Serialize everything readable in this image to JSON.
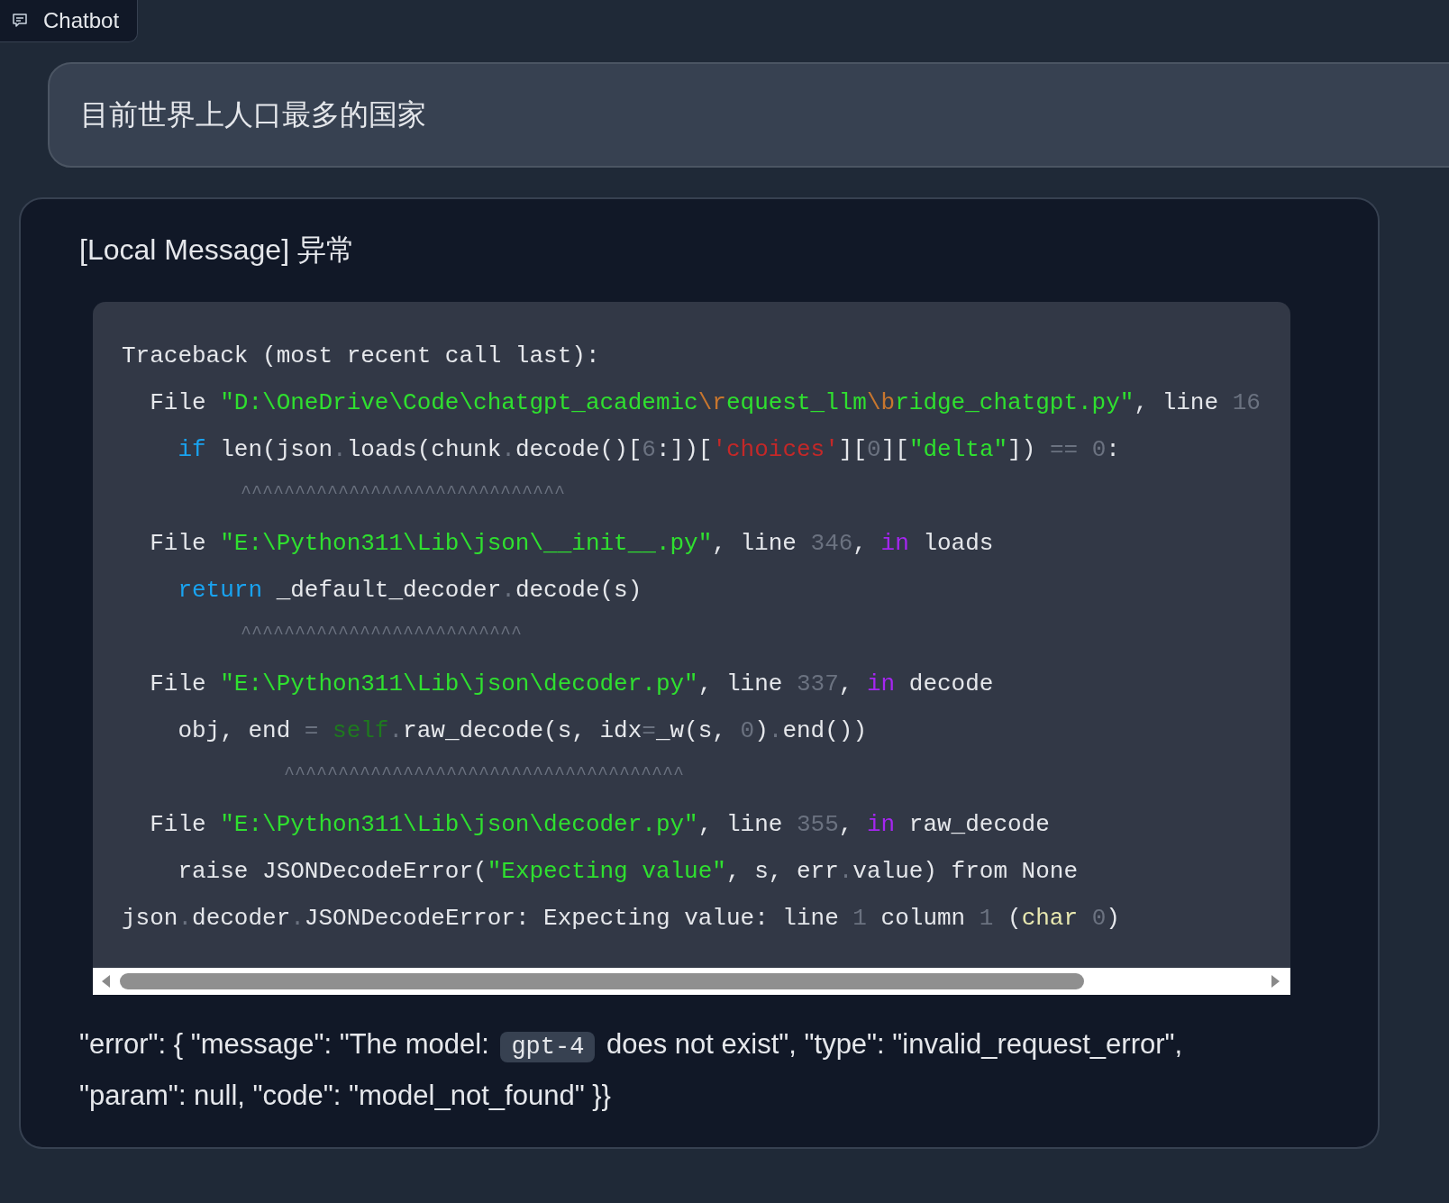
{
  "header_tab": {
    "label": "Chatbot"
  },
  "messages": [
    {
      "kind": "user",
      "text": "目前世界上人口最多的国家"
    },
    {
      "kind": "bot",
      "title": "[Local Message] 异常",
      "code_lines": [
        {
          "kind": "code",
          "tokens": [
            {
              "kind": "t",
              "text": "Traceback (most recent call last):"
            }
          ]
        },
        {
          "kind": "code",
          "tokens": [
            {
              "kind": "t",
              "text": "  File "
            },
            {
              "kind": "s",
              "text": "\"D:\\OneDrive\\Code\\chatgpt_academic"
            },
            {
              "kind": "e",
              "text": "\\r"
            },
            {
              "kind": "s",
              "text": "equest_llm"
            },
            {
              "kind": "e",
              "text": "\\b"
            },
            {
              "kind": "s",
              "text": "ridge_chatgpt.py\""
            },
            {
              "kind": "t",
              "text": ", line "
            },
            {
              "kind": "n",
              "text": "16"
            }
          ]
        },
        {
          "kind": "code",
          "tokens": [
            {
              "kind": "k",
              "text": "    if"
            },
            {
              "kind": "t",
              "text": " len(json"
            },
            {
              "kind": "o",
              "text": "."
            },
            {
              "kind": "t",
              "text": "loads(chunk"
            },
            {
              "kind": "o",
              "text": "."
            },
            {
              "kind": "t",
              "text": "decode()["
            },
            {
              "kind": "n",
              "text": "6"
            },
            {
              "kind": "t",
              "text": ":])["
            },
            {
              "kind": "r",
              "text": "'choices'"
            },
            {
              "kind": "t",
              "text": "]["
            },
            {
              "kind": "n",
              "text": "0"
            },
            {
              "kind": "t",
              "text": "]["
            },
            {
              "kind": "s",
              "text": "\"delta\""
            },
            {
              "kind": "t",
              "text": "]) "
            },
            {
              "kind": "o",
              "text": "=="
            },
            {
              "kind": "n",
              "text": " 0"
            },
            {
              "kind": "t",
              "text": ":"
            }
          ]
        },
        {
          "kind": "carets",
          "text": "           ^^^^^^^^^^^^^^^^^^^^^^^^^^^^^^"
        },
        {
          "kind": "code",
          "tokens": [
            {
              "kind": "t",
              "text": "  File "
            },
            {
              "kind": "s",
              "text": "\"E:\\Python311\\Lib\\json\\__init__.py\""
            },
            {
              "kind": "t",
              "text": ", line "
            },
            {
              "kind": "n",
              "text": "346"
            },
            {
              "kind": "t",
              "text": ", "
            },
            {
              "kind": "p",
              "text": "in"
            },
            {
              "kind": "t",
              "text": " loads"
            }
          ]
        },
        {
          "kind": "code",
          "tokens": [
            {
              "kind": "k",
              "text": "    return"
            },
            {
              "kind": "t",
              "text": " _default_decoder"
            },
            {
              "kind": "o",
              "text": "."
            },
            {
              "kind": "t",
              "text": "decode(s)"
            }
          ]
        },
        {
          "kind": "carets",
          "text": "           ^^^^^^^^^^^^^^^^^^^^^^^^^^"
        },
        {
          "kind": "code",
          "tokens": [
            {
              "kind": "t",
              "text": "  File "
            },
            {
              "kind": "s",
              "text": "\"E:\\Python311\\Lib\\json\\decoder.py\""
            },
            {
              "kind": "t",
              "text": ", line "
            },
            {
              "kind": "n",
              "text": "337"
            },
            {
              "kind": "t",
              "text": ", "
            },
            {
              "kind": "p",
              "text": "in"
            },
            {
              "kind": "t",
              "text": " decode"
            }
          ]
        },
        {
          "kind": "code",
          "tokens": [
            {
              "kind": "t",
              "text": "    obj, end "
            },
            {
              "kind": "o",
              "text": "="
            },
            {
              "kind": "d",
              "text": " self"
            },
            {
              "kind": "o",
              "text": "."
            },
            {
              "kind": "t",
              "text": "raw_decode(s, idx"
            },
            {
              "kind": "o",
              "text": "="
            },
            {
              "kind": "t",
              "text": "_w(s, "
            },
            {
              "kind": "n",
              "text": "0"
            },
            {
              "kind": "t",
              "text": ")"
            },
            {
              "kind": "o",
              "text": "."
            },
            {
              "kind": "t",
              "text": "end())"
            }
          ]
        },
        {
          "kind": "carets",
          "text": "               ^^^^^^^^^^^^^^^^^^^^^^^^^^^^^^^^^^^^^"
        },
        {
          "kind": "code",
          "tokens": [
            {
              "kind": "t",
              "text": "  File "
            },
            {
              "kind": "s",
              "text": "\"E:\\Python311\\Lib\\json\\decoder.py\""
            },
            {
              "kind": "t",
              "text": ", line "
            },
            {
              "kind": "n",
              "text": "355"
            },
            {
              "kind": "t",
              "text": ", "
            },
            {
              "kind": "p",
              "text": "in"
            },
            {
              "kind": "t",
              "text": " raw_decode"
            }
          ]
        },
        {
          "kind": "code",
          "tokens": [
            {
              "kind": "t",
              "text": "    raise JSONDecodeError("
            },
            {
              "kind": "s",
              "text": "\"Expecting value\""
            },
            {
              "kind": "t",
              "text": ", s, err"
            },
            {
              "kind": "o",
              "text": "."
            },
            {
              "kind": "t",
              "text": "value) from None"
            }
          ]
        },
        {
          "kind": "code",
          "tokens": [
            {
              "kind": "t",
              "text": "json"
            },
            {
              "kind": "o",
              "text": "."
            },
            {
              "kind": "t",
              "text": "decoder"
            },
            {
              "kind": "o",
              "text": "."
            },
            {
              "kind": "t",
              "text": "JSONDecodeError: Expecting value: line "
            },
            {
              "kind": "n",
              "text": "1"
            },
            {
              "kind": "t",
              "text": " column "
            },
            {
              "kind": "n",
              "text": "1"
            },
            {
              "kind": "t",
              "text": " ("
            },
            {
              "kind": "y",
              "text": "char"
            },
            {
              "kind": "n",
              "text": " 0"
            },
            {
              "kind": "t",
              "text": ")"
            }
          ]
        }
      ],
      "error_text": {
        "before": "\"error\": { \"message\": \"The model:",
        "inline_code": "gpt-4",
        "after": "does not exist\", \"type\": \"invalid_request_error\", \"param\": null, \"code\": \"model_not_found\" }}"
      }
    }
  ]
}
